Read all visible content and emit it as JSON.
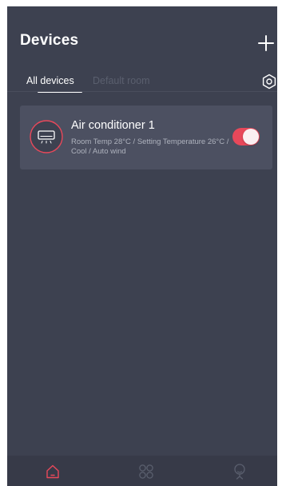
{
  "header": {
    "title": "Devices",
    "add_icon": "plus-icon",
    "settings_icon": "hexagon-settings-icon"
  },
  "tabs": [
    {
      "label": "All devices",
      "active": true
    },
    {
      "label": "Default room",
      "active": false
    }
  ],
  "devices": [
    {
      "name": "Air conditioner 1",
      "status": "Room Temp 28°C / Setting Temperature 26°C / Cool / Auto wind",
      "icon": "air-conditioner-icon",
      "power_on": true
    }
  ],
  "bottom_nav": [
    {
      "icon": "home-icon",
      "active": true
    },
    {
      "icon": "apps-grid-icon",
      "active": false
    },
    {
      "icon": "profile-icon",
      "active": false
    }
  ],
  "colors": {
    "background": "#3d4150",
    "card": "#4c5061",
    "accent": "#e8485a",
    "inactive_icon": "#5a5f6e"
  }
}
